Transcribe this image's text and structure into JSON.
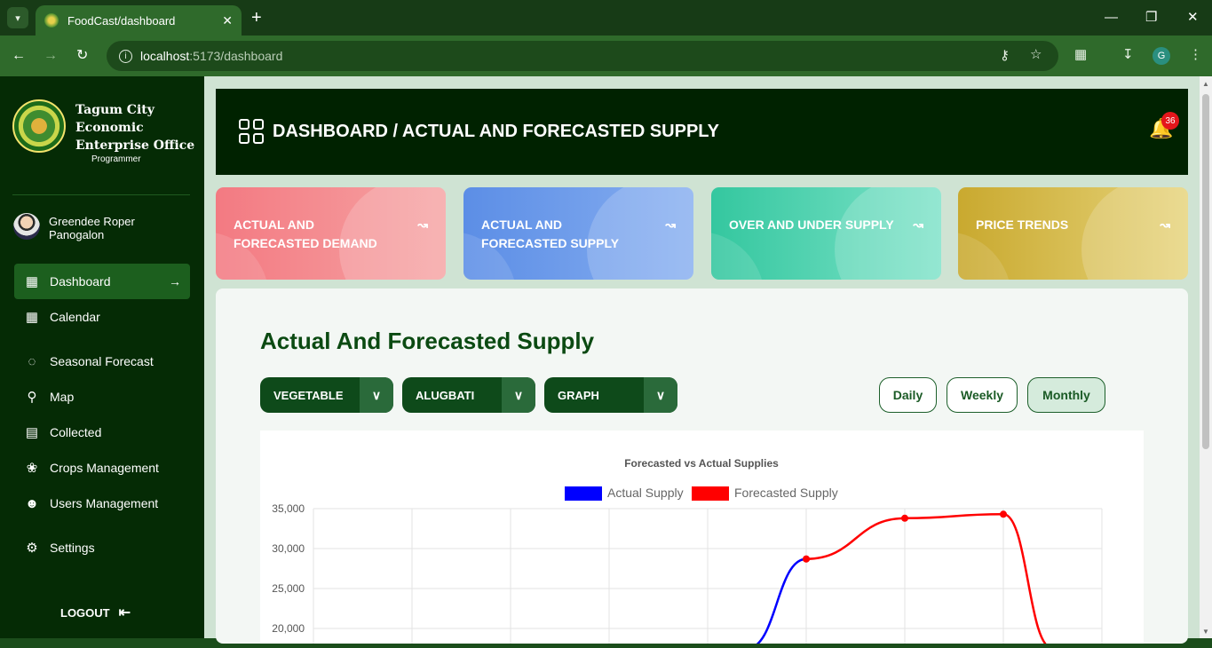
{
  "browser": {
    "tab_title": "FoodCast/dashboard",
    "url_host": "localhost",
    "url_path": ":5173/dashboard",
    "profile_initial": "G"
  },
  "sidebar": {
    "org_name": "Tagum City Economic Enterprise Office",
    "role": "Programmer",
    "user_name": "Greendee Roper Panogalon",
    "items": [
      {
        "label": "Dashboard",
        "icon": "dashboard-grid-icon",
        "active": true
      },
      {
        "label": "Calendar",
        "icon": "calendar-icon"
      },
      {
        "label": "Seasonal Forecast",
        "icon": "spiral-icon"
      },
      {
        "label": "Map",
        "icon": "map-pin-icon"
      },
      {
        "label": "Collected",
        "icon": "collected-icon"
      },
      {
        "label": "Crops Management",
        "icon": "sprout-icon"
      },
      {
        "label": "Users Management",
        "icon": "users-icon"
      },
      {
        "label": "Settings",
        "icon": "gear-icon"
      }
    ],
    "logout_label": "LOGOUT"
  },
  "header": {
    "title": "DASHBOARD / ACTUAL AND FORECASTED SUPPLY",
    "notification_count": "36"
  },
  "cards": [
    {
      "label": "ACTUAL AND FORECASTED DEMAND",
      "color": "#f47b82"
    },
    {
      "label": "ACTUAL AND FORECASTED SUPPLY",
      "color": "#5f8fe6"
    },
    {
      "label": "OVER AND UNDER SUPPLY",
      "color": "#3dcaa2"
    },
    {
      "label": "PRICE TRENDS",
      "color": "#d2b03c"
    }
  ],
  "content": {
    "title": "Actual And Forecasted Supply",
    "filters": [
      "VEGETABLE",
      "ALUGBATI",
      "GRAPH"
    ],
    "periods": [
      "Daily",
      "Weekly",
      "Monthly"
    ],
    "active_period": "Monthly"
  },
  "chart_data": {
    "type": "line",
    "title": "Forecasted vs Actual Supplies",
    "y_ticks": [
      "35,000",
      "30,000",
      "25,000",
      "20,000"
    ],
    "ylim": [
      20000,
      35000
    ],
    "x_count": 9,
    "series": [
      {
        "name": "Actual Supply",
        "color": "#0000ff",
        "points": [
          [
            4.4,
            17500
          ],
          [
            5,
            28700
          ]
        ]
      },
      {
        "name": "Forecasted Supply",
        "color": "#ff0000",
        "points": [
          [
            5,
            28700
          ],
          [
            6,
            33800
          ],
          [
            7,
            34300
          ],
          [
            7.5,
            17500
          ]
        ]
      }
    ],
    "legend": "top-center",
    "grid": true
  }
}
